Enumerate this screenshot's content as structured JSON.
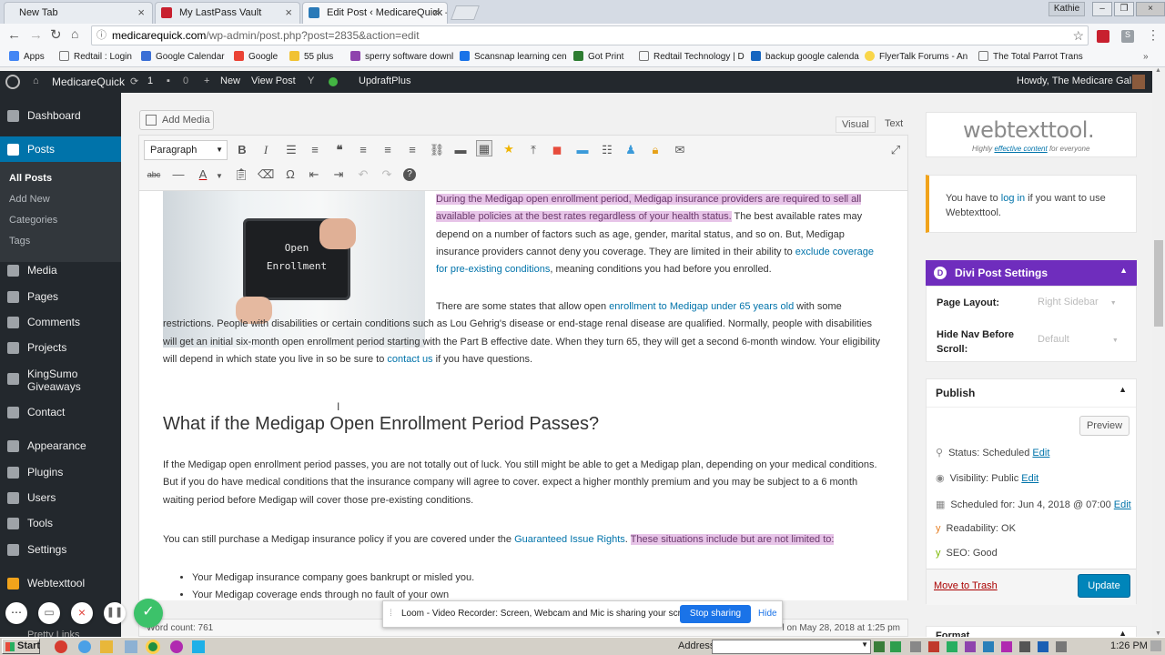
{
  "browser": {
    "tabs": [
      {
        "title": "New Tab"
      },
      {
        "title": "My LastPass Vault"
      },
      {
        "title": "Edit Post ‹ MedicareQuick –"
      }
    ],
    "user_chip": "Kathie",
    "url_host": "medicarequick.com",
    "url_path": "/wp-admin/post.php?post=2835&action=edit",
    "bookmarks": [
      "Apps",
      "Redtail : Login",
      "Google Calendar",
      "Google",
      "55 plus",
      "sperry software downl",
      "Scansnap learning cen",
      "Got Print",
      "Redtail Technology | D",
      "backup google calenda",
      "FlyerTalk Forums - An",
      "The Total Parrot Trans"
    ]
  },
  "adminbar": {
    "site": "MedicareQuick",
    "updates": "1",
    "comments": "0",
    "new": "New",
    "view": "View Post",
    "updraft": "UpdraftPlus",
    "howdy": "Howdy, The Medicare Gal"
  },
  "menu": {
    "dashboard": "Dashboard",
    "posts": "Posts",
    "all_posts": "All Posts",
    "add_new": "Add New",
    "categories": "Categories",
    "tags": "Tags",
    "media": "Media",
    "pages": "Pages",
    "comments": "Comments",
    "projects": "Projects",
    "kingsumo": "KingSumo Giveaways",
    "contact": "Contact",
    "appearance": "Appearance",
    "plugins": "Plugins",
    "users": "Users",
    "tools": "Tools",
    "settings": "Settings",
    "webtexttool": "Webtexttool",
    "pretty": "Pretty Links"
  },
  "editor": {
    "add_media": "Add Media",
    "visual": "Visual",
    "text": "Text",
    "format": "Paragraph",
    "image_line1": "Open",
    "image_line2": "Enrollment",
    "p1_hl": "During the Medigap open enrollment period, Medigap insurance providers are required to sell all available policies at the best rates regardless of your health status.",
    "p1_a": " The best available rates may depend on a number of factors such as age, gender, marital status, and so on. But, Medigap insurance providers cannot deny you coverage. They are limited in their ability to ",
    "p1_link": "exclude coverage for pre-existing conditions",
    "p1_b": ", meaning conditions you had before you enrolled.",
    "p2_a": "There are some states that allow open ",
    "p2_link": "enrollment to Medigap under 65 years old",
    "p2_b": " with some restrictions. People with disabilities or certain conditions such as Lou Gehrig's disease or end-stage renal disease are qualified. Normally, people with disabilities will get an initial six-month open enrollment period starting with the Part B effective date. When they turn 65, they will get a second 6-month window. Your eligibility will depend in which state you live in so be sure to ",
    "p2_link2": "contact us",
    "p2_c": " if you have questions.",
    "h2": "What if the Medigap Open Enrollment Period Passes?",
    "p3": "If the Medigap open enrollment period passes, you are not totally out of luck. You still might be able to get a Medigap plan, depending on your medical conditions.  But if you do have medical conditions that the insurance company will agree to cover. expect a higher monthly premium and you may be subject to a 6 month waiting period before Medigap will cover those pre-existing conditions.",
    "p4_a": "You can still purchase a Medigap insurance policy if you are covered under the ",
    "p4_link": "Guaranteed Issue Rights",
    "p4_b": ". ",
    "p4_hl": "These situations include but are not limited to:",
    "li1": "Your Medigap insurance company goes bankrupt or misled you.",
    "li2": "Your Medigap coverage ends through no fault of your own",
    "word_count": "Word count: 761",
    "last_edited": "l on May 28, 2018 at 1:25 pm"
  },
  "side": {
    "wtt_logo": "webtexttool.",
    "wtt_tag_a": "Highly ",
    "wtt_tag_link": "effective content",
    "wtt_tag_b": " for everyone",
    "wtt_msg_a": "You have to ",
    "wtt_msg_link": "log in",
    "wtt_msg_b": " if you want to use Webtexttool.",
    "divi_title": "Divi Post Settings",
    "page_layout": "Page Layout:",
    "page_layout_val": "Right Sidebar",
    "hide_nav": "Hide Nav Before Scroll:",
    "hide_nav_val": "Default",
    "publish": "Publish",
    "preview": "Preview",
    "status": "Status: Scheduled",
    "visibility": "Visibility: Public",
    "scheduled": "Scheduled for: Jun 4, 2018 @ 07:00",
    "edit": "Edit",
    "readability": "Readability: OK",
    "seo": "SEO: Good",
    "trash": "Move to Trash",
    "update": "Update",
    "format": "Format"
  },
  "loom": {
    "msg": "Loom - Video Recorder: Screen, Webcam and Mic is sharing your screen.",
    "stop": "Stop sharing",
    "hide": "Hide"
  },
  "taskbar": {
    "start": "Start",
    "address": "Address",
    "time": "1:26 PM"
  },
  "colors": {
    "wp_blue": "#0073aa",
    "divi_purple": "#6f2dbd",
    "admin_dark": "#23282d"
  }
}
